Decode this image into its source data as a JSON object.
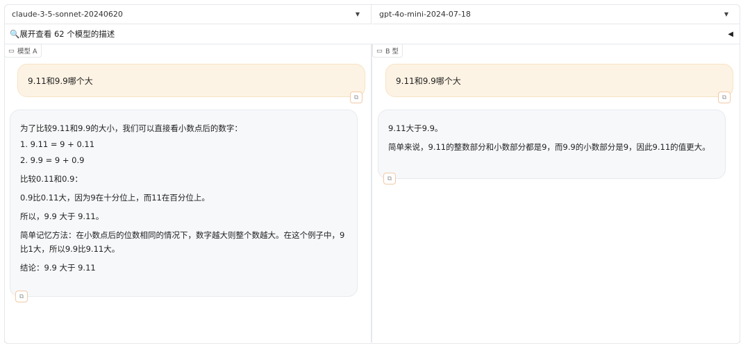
{
  "model_selectors": {
    "a": "claude-3-5-sonnet-20240620",
    "b": "gpt-4o-mini-2024-07-18"
  },
  "accordion": {
    "icon": "🔍",
    "label": "展开查看 62 个模型的描述"
  },
  "panel_a": {
    "label": "模型 A",
    "user_message": "9.11和9.9哪个大",
    "bot_paragraphs": [
      "为了比较9.11和9.9的大小，我们可以直接看小数点后的数字：",
      "1. 9.11 = 9 + 0.11",
      "2. 9.9 = 9 + 0.9",
      "比较0.11和0.9：",
      "0.9比0.11大，因为9在十分位上，而11在百分位上。",
      "所以，9.9 大于 9.11。",
      "简单记忆方法：在小数点后的位数相同的情况下，数字越大则整个数越大。在这个例子中，9比1大，所以9.9比9.11大。",
      "结论：9.9 大于 9.11"
    ]
  },
  "panel_b": {
    "label": "B 型",
    "user_message": "9.11和9.9哪个大",
    "bot_paragraphs": [
      "9.11大于9.9。",
      "简单来说，9.11的整数部分和小数部分都是9，而9.9的小数部分是9，因此9.11的值更大。"
    ]
  }
}
